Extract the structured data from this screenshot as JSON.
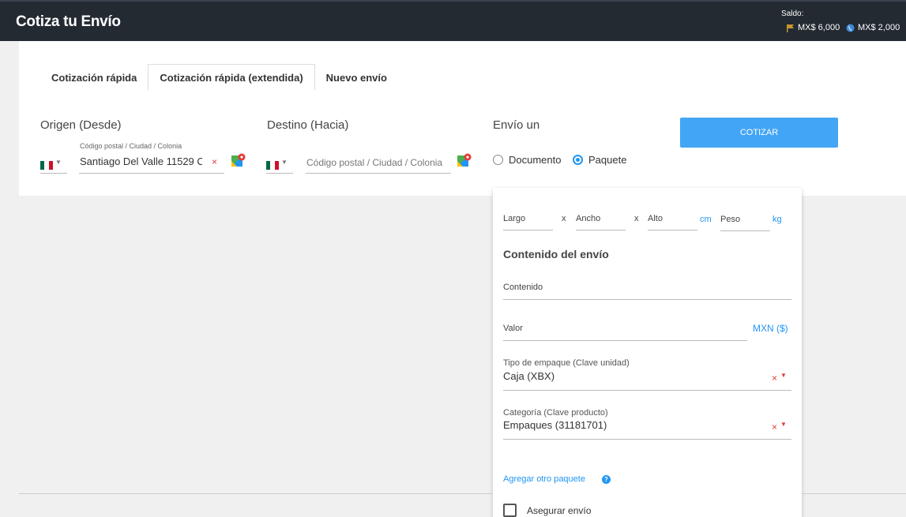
{
  "header": {
    "title": "Cotiza tu Envío",
    "saldo_label": "Saldo:",
    "balances": [
      {
        "icon": "flag-icon",
        "value": "MX$ 6,000"
      },
      {
        "icon": "globe-icon",
        "value": "MX$ 2,000"
      }
    ]
  },
  "tabs": [
    {
      "label": "Cotización rápida",
      "active": false
    },
    {
      "label": "Cotización rápida (extendida)",
      "active": true
    },
    {
      "label": "Nuevo envío",
      "active": false
    }
  ],
  "origin": {
    "label": "Origen (Desde)",
    "field_label": "Código postal / Ciudad / Colonia",
    "value": "Santiago Del Valle 11529 C",
    "clear": "×"
  },
  "destination": {
    "label": "Destino (Hacia)",
    "placeholder": "Código postal / Ciudad / Colonia"
  },
  "shipment_type": {
    "label": "Envío un",
    "options": [
      {
        "label": "Documento",
        "selected": false
      },
      {
        "label": "Paquete",
        "selected": true
      }
    ]
  },
  "cotizar_button": "COTIZAR",
  "package": {
    "dims": {
      "largo": "Largo",
      "ancho": "Ancho",
      "alto": "Alto",
      "x": "x",
      "unit_cm": "cm",
      "peso": "Peso",
      "unit_kg": "kg"
    },
    "contents_title": "Contenido del envío",
    "contenido_placeholder": "Contenido",
    "valor_placeholder": "Valor",
    "valor_unit": "MXN ($)",
    "empaque": {
      "label": "Tipo de empaque (Clave unidad)",
      "value": "Caja (XBX)"
    },
    "categoria": {
      "label": "Categoría (Clave producto)",
      "value": "Empaques (31181701)"
    },
    "clear": "×",
    "add_package": "Agregar otro paquete",
    "help": "?",
    "insure": "Asegurar envío"
  },
  "colors": {
    "topbar": "#232a32",
    "accent": "#2196f3",
    "button": "#42a5f5",
    "clear": "#e53935"
  }
}
